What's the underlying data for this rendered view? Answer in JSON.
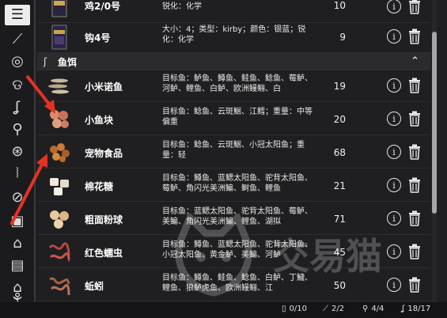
{
  "top_rows": [
    {
      "name": "鸡2/0号",
      "desc": "锐化：化学",
      "qty": "10"
    },
    {
      "name": "钩4号",
      "desc": "大小：4；类型：kirby；颜色：银蓝；锐化：化学",
      "qty": "9"
    }
  ],
  "section": {
    "title": "鱼饵"
  },
  "bait_rows": [
    {
      "name": "小米诺鱼",
      "desc": "目标鱼：鲈鱼、鳟鱼、鲑鱼、鲶鱼、莓鲈、河鲈、鲤鱼、白鲈、欧洲鳗鲡、白",
      "qty": "19"
    },
    {
      "name": "小鱼块",
      "desc": "目标鱼：鲶鱼、云斑鮰、江鳕；重量：中等偏重",
      "qty": "20"
    },
    {
      "name": "宠物食品",
      "desc": "目标鱼：鲶鱼、云斑鮰、小冠太阳鱼；重量：轻",
      "qty": "68"
    },
    {
      "name": "棉花糖",
      "desc": "目标鱼：鳟鱼、蓝鳃太阳鱼、驼背太阳鱼、莓鲈、角闪光美洲鳊、鲥鱼、鲤鱼",
      "qty": "21"
    },
    {
      "name": "粗面粉球",
      "desc": "目标鱼：蓝鳃太阳鱼、驼背太阳鱼、莓鲈、美鳊、角闪光美洲鳊、鲤鱼、湖拟",
      "qty": "71"
    },
    {
      "name": "红色蠕虫",
      "desc": "目标鱼：鳟鱼、蓝鳃太阳鱼、驼背太阳鱼、小冠太阳鱼、黄金鲈、美鳊、河鲈",
      "qty": "45"
    },
    {
      "name": "蚯蚓",
      "desc": "目标鱼：鳟鱼、鲑鱼、鲶鱼、白鲈、丁鱥、鲤鱼、狼鲈虎鱼、欧洲鳗鲡、江",
      "qty": "50"
    }
  ],
  "statusbar": {
    "s1": "0/10",
    "s2": "2/2",
    "s3": "4/4",
    "s4": "18/17"
  },
  "watermark": {
    "text": "交易猫"
  },
  "icons": {
    "sidebar": [
      "drawer-icon",
      "rod-icon",
      "reel-icon",
      "line-icon",
      "hook-icon",
      "lure-icon",
      "fish-icon",
      "float-icon",
      "sinker-icon",
      "net-icon",
      "keepnet-icon",
      "tackle-box-icon",
      "boat-house-icon",
      "plant-icon"
    ],
    "info": "info-circle-icon",
    "delete": "trash-icon"
  },
  "colors": {
    "background": "#1f1f21",
    "arrow": "#e53224",
    "scroll_thumb": "#a6a6a8"
  }
}
